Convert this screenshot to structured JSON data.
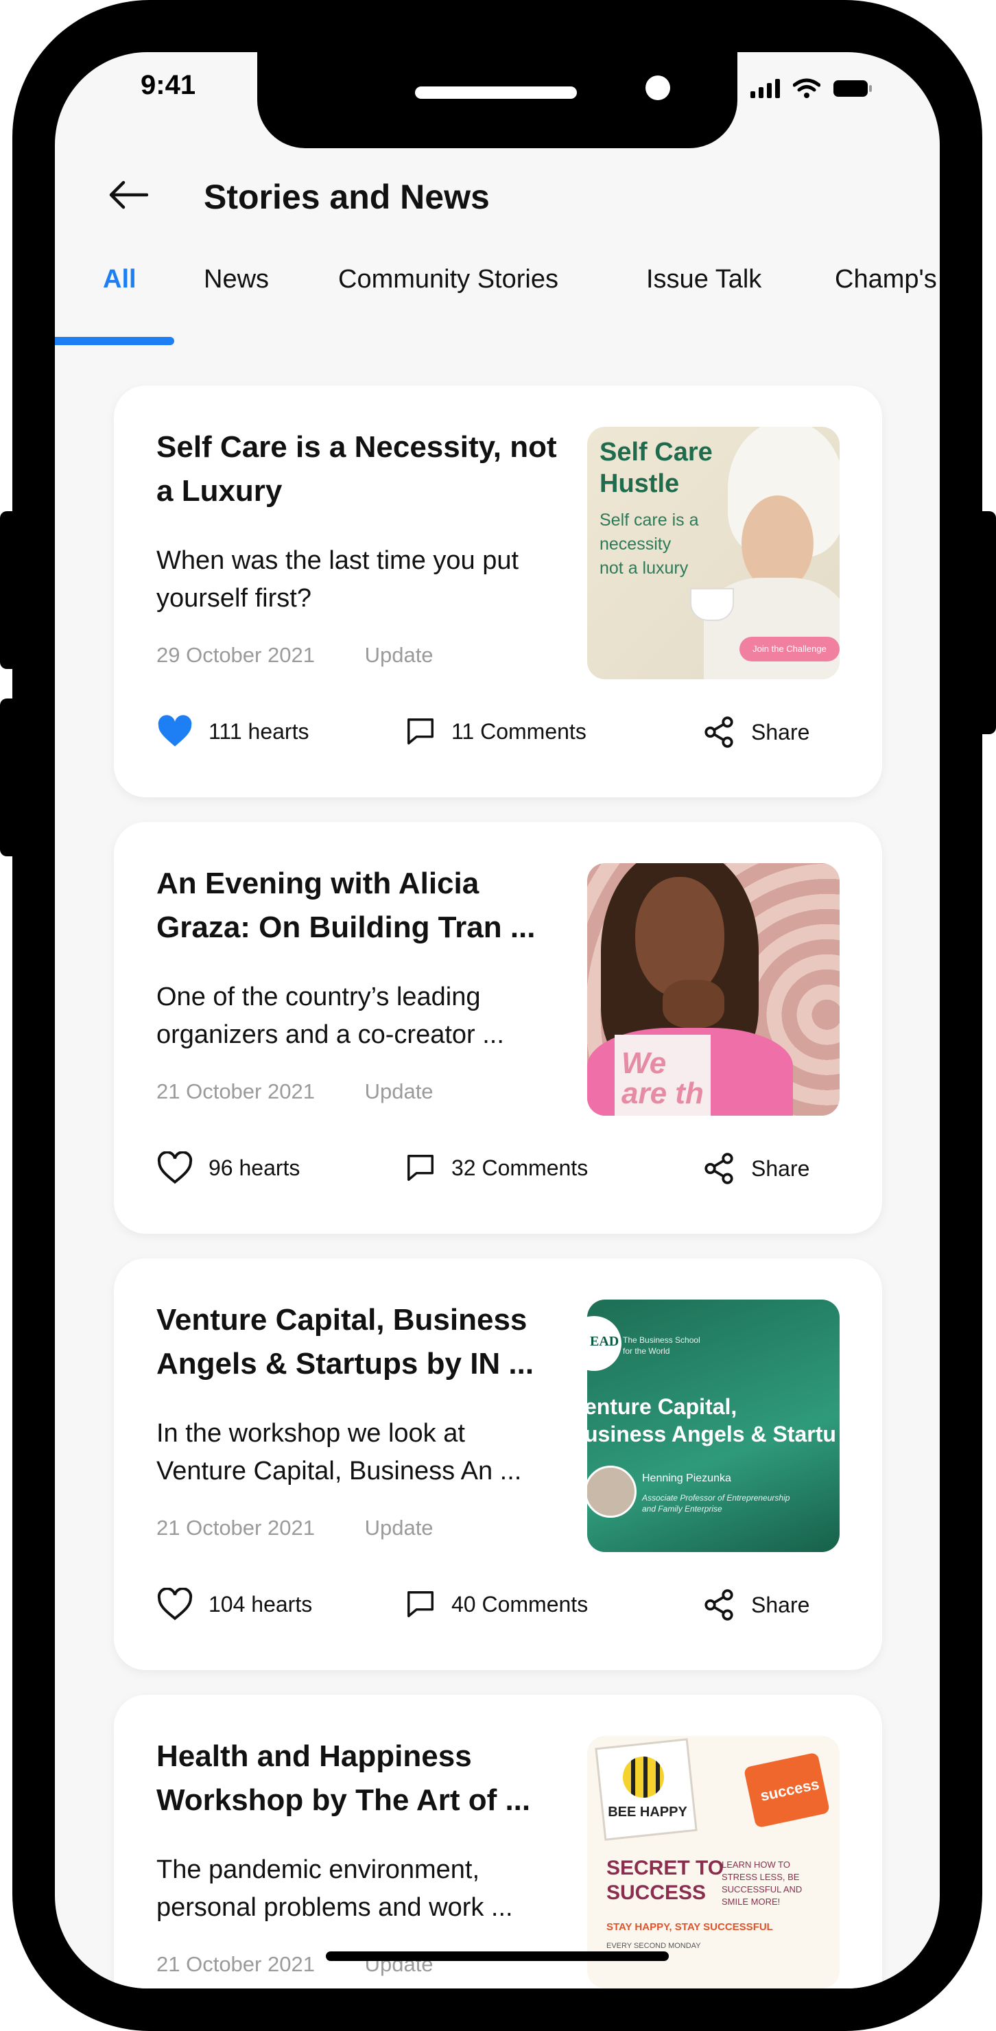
{
  "status_bar": {
    "time": "9:41"
  },
  "header": {
    "title": "Stories and News"
  },
  "tabs": [
    {
      "label": "All",
      "active": true
    },
    {
      "label": "News"
    },
    {
      "label": "Community Stories"
    },
    {
      "label": "Issue Talk"
    },
    {
      "label": "Champ's"
    }
  ],
  "accent_color": "#1d7ff3",
  "cards": [
    {
      "title": "Self Care is a Necessity, not a Luxury",
      "excerpt": "When was the last time you put yourself first?",
      "date": "29 October 2021",
      "tag": "Update",
      "hearts": "111 hearts",
      "liked": true,
      "comments": "11 Comments",
      "share": "Share",
      "image": {
        "heading": "Self Care Hustle",
        "line1": "Self care is a",
        "line2": "necessity",
        "line3": "not a luxury",
        "pill": "Join the Challenge"
      }
    },
    {
      "title": "An Evening with Alicia Graza: On Building Tran ...",
      "excerpt": "One of the country’s leading organizers and a co-creator ...",
      "date": "21 October 2021",
      "tag": "Update",
      "hearts": "96 hearts",
      "liked": false,
      "comments": "32 Comments",
      "share": "Share",
      "image": {
        "shirt_text": "We are th"
      }
    },
    {
      "title": "Venture Capital, Business Angels & Startups by IN ...",
      "excerpt": "In the workshop we look at Venture Capital, Business An ...",
      "date": "21 October 2021",
      "tag": "Update",
      "hearts": "104 hearts",
      "liked": false,
      "comments": "40 Comments",
      "share": "Share",
      "image": {
        "logo": "EAD",
        "tagline1": "The Business School",
        "tagline2": "for the World",
        "heading1": "enture Capital,",
        "heading2": "usiness Angels & Startu",
        "speaker": "Henning Piezunka",
        "role1": "Associate Professor of Entrepreneurship",
        "role2": "and Family Enterprise"
      }
    },
    {
      "title": "Health and Happiness Workshop by The Art of ...",
      "excerpt": "The pandemic environment, personal problems and work ...",
      "date": "21 October 2021",
      "tag": "Update",
      "image": {
        "bee": "BEE HAPPY",
        "puzzle": "success",
        "heading1": "SECRET TO",
        "heading2": "SUCCESS",
        "right1": "LEARN HOW TO",
        "right2": "STRESS LESS, BE",
        "right3": "SUCCESSFUL AND",
        "right4": "SMILE MORE!",
        "tagline": "STAY HAPPY, STAY SUCCESSFUL",
        "schedule": "EVERY SECOND MONDAY"
      }
    }
  ]
}
